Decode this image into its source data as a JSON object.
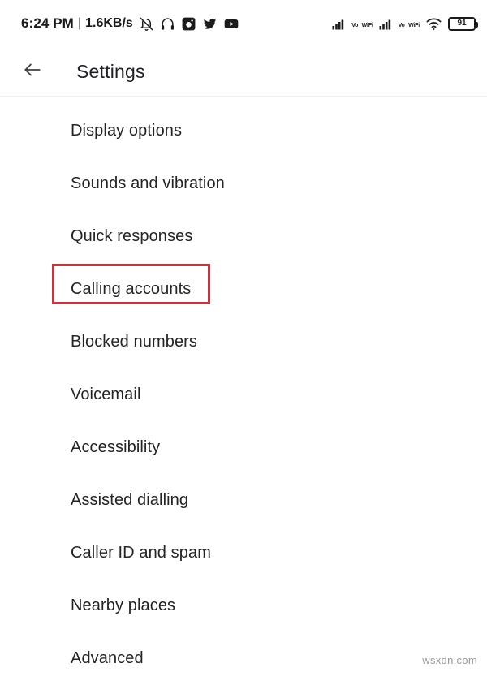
{
  "status_bar": {
    "time": "6:24 PM",
    "separator": "|",
    "data_rate": "1.6KB/s",
    "left_icons": [
      "bell-muted-icon",
      "headphone-icon",
      "instagram-icon",
      "twitter-icon",
      "youtube-icon"
    ],
    "right_icons": [
      "signal-bars-icon",
      "volte-wifi-label",
      "signal-bars-icon",
      "volte-wifi-label",
      "wifi-icon"
    ],
    "volte_line1": "Vo",
    "volte_line2": "WiFi",
    "battery_level": "91"
  },
  "app_bar": {
    "back_icon": "back-arrow-icon",
    "title": "Settings"
  },
  "settings": {
    "items": [
      {
        "label": "Display options",
        "highlighted": false
      },
      {
        "label": "Sounds and vibration",
        "highlighted": false
      },
      {
        "label": "Quick responses",
        "highlighted": false
      },
      {
        "label": "Calling accounts",
        "highlighted": true
      },
      {
        "label": "Blocked numbers",
        "highlighted": false
      },
      {
        "label": "Voicemail",
        "highlighted": false
      },
      {
        "label": "Accessibility",
        "highlighted": false
      },
      {
        "label": "Assisted dialling",
        "highlighted": false
      },
      {
        "label": "Caller ID and spam",
        "highlighted": false
      },
      {
        "label": "Nearby places",
        "highlighted": false
      },
      {
        "label": "Advanced",
        "highlighted": false
      }
    ]
  },
  "annotation": {
    "target_label": "Calling accounts",
    "color": "#bd3942"
  },
  "watermark": {
    "text": "wsxdn.com"
  }
}
